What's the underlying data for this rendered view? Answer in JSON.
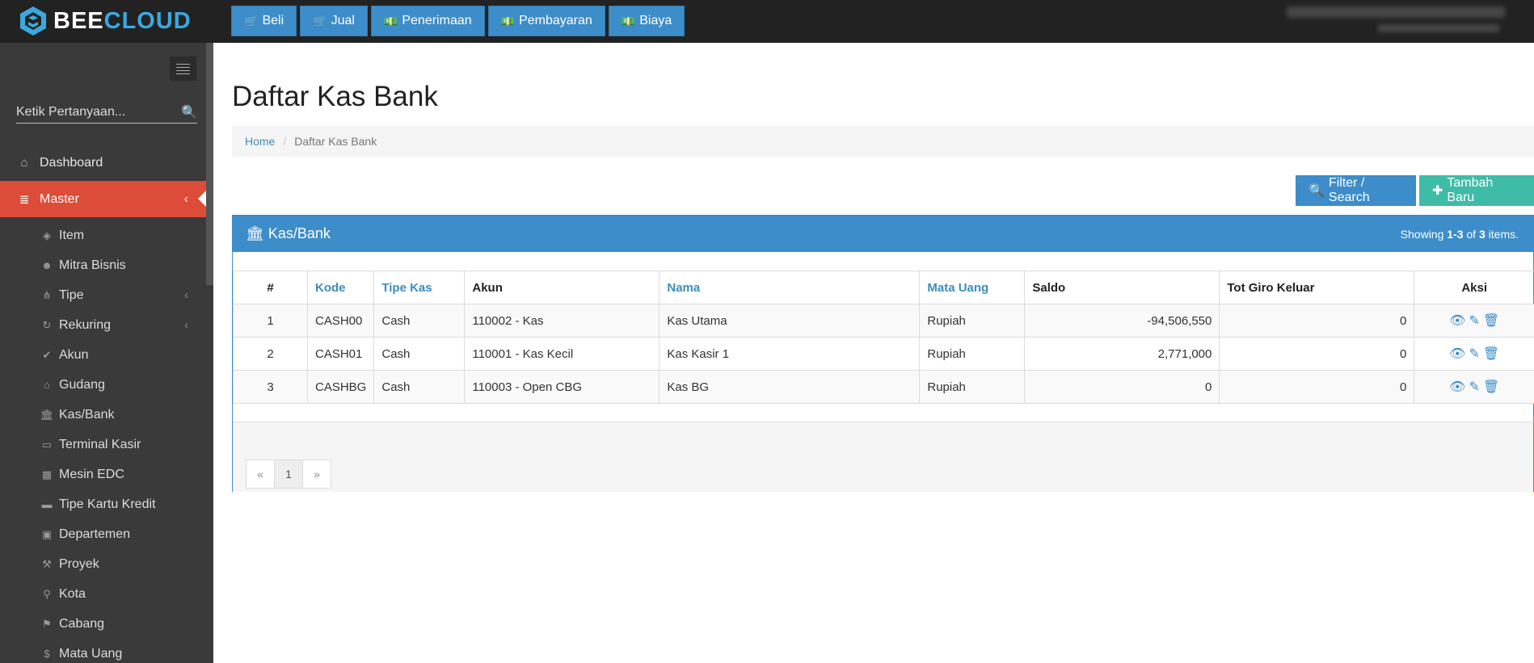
{
  "app": {
    "logo_bee": "BEE",
    "logo_cloud": "CLOUD"
  },
  "topnav": [
    {
      "label": "Beli",
      "icon": "cart-icon"
    },
    {
      "label": "Jual",
      "icon": "cart-icon"
    },
    {
      "label": "Penerimaan",
      "icon": "money-icon"
    },
    {
      "label": "Pembayaran",
      "icon": "money-icon"
    },
    {
      "label": "Biaya",
      "icon": "money-icon"
    }
  ],
  "sidebar": {
    "search_placeholder": "Ketik Pertanyaan...",
    "items": [
      {
        "label": "Dashboard",
        "icon": "home-icon"
      },
      {
        "label": "Master",
        "icon": "database-icon",
        "active": true
      }
    ],
    "submenu": [
      {
        "label": "Item",
        "icon": "cube-icon"
      },
      {
        "label": "Mitra Bisnis",
        "icon": "users-icon"
      },
      {
        "label": "Tipe",
        "icon": "sitemap-icon"
      },
      {
        "label": "Rekuring",
        "icon": "refresh-icon"
      },
      {
        "label": "Akun",
        "icon": "check-icon"
      },
      {
        "label": "Gudang",
        "icon": "home-icon"
      },
      {
        "label": "Kas/Bank",
        "icon": "bank-icon"
      },
      {
        "label": "Terminal Kasir",
        "icon": "desktop-icon"
      },
      {
        "label": "Mesin EDC",
        "icon": "calculator-icon"
      },
      {
        "label": "Tipe Kartu Kredit",
        "icon": "credit-card-icon"
      },
      {
        "label": "Departemen",
        "icon": "clipboard-icon"
      },
      {
        "label": "Proyek",
        "icon": "gavel-icon"
      },
      {
        "label": "Kota",
        "icon": "map-marker-icon"
      },
      {
        "label": "Cabang",
        "icon": "flag-icon"
      },
      {
        "label": "Mata Uang",
        "icon": "dollar-icon"
      }
    ]
  },
  "page": {
    "title": "Daftar Kas Bank",
    "breadcrumb_home": "Home",
    "breadcrumb_current": "Daftar Kas Bank"
  },
  "actions": {
    "filter_label": "Filter / Search",
    "add_label": "Tambah Baru"
  },
  "panel": {
    "title": "Kas/Bank",
    "summary_prefix": "Showing ",
    "summary_range": "1-3",
    "summary_of": " of ",
    "summary_total": "3",
    "summary_suffix": " items."
  },
  "table": {
    "headers": [
      "#",
      "Kode",
      "Tipe Kas",
      "Akun",
      "Nama",
      "Mata Uang",
      "Saldo",
      "Tot Giro Keluar",
      "Aksi"
    ],
    "rows": [
      {
        "no": "1",
        "kode": "CASH00",
        "tipe": "Cash",
        "akun": "110002 - Kas",
        "nama": "Kas Utama",
        "mata_uang": "Rupiah",
        "saldo": "-94,506,550",
        "giro": "0"
      },
      {
        "no": "2",
        "kode": "CASH01",
        "tipe": "Cash",
        "akun": "110001 - Kas Kecil",
        "nama": "Kas Kasir 1",
        "mata_uang": "Rupiah",
        "saldo": "2,771,000",
        "giro": "0"
      },
      {
        "no": "3",
        "kode": "CASHBG",
        "tipe": "Cash",
        "akun": "110003 - Open CBG",
        "nama": "Kas BG",
        "mata_uang": "Rupiah",
        "saldo": "0",
        "giro": "0"
      }
    ]
  },
  "pager": {
    "prev": "«",
    "page": "1",
    "next": "»"
  },
  "colors": {
    "primary": "#3c8dca",
    "success": "#3fbca7",
    "active_menu": "#dd4b39",
    "sidebar": "#3a3a3a",
    "topbar": "#222222"
  }
}
